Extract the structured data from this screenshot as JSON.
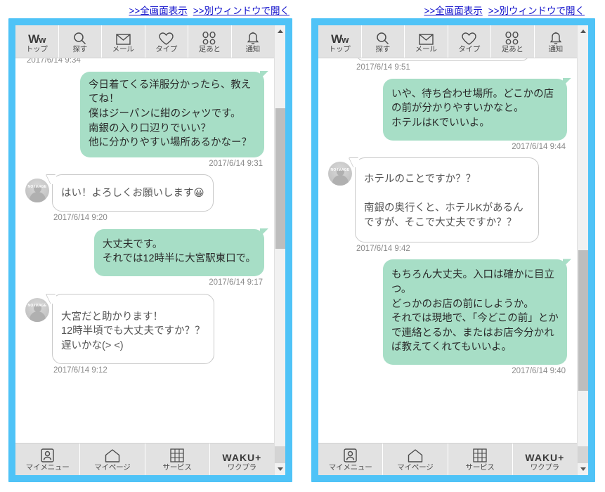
{
  "page": {
    "background": "#ffffff",
    "frame_color": "#4fc3f7",
    "bubble_out_color": "#a7dec6",
    "bubble_in_color": "#ffffff",
    "link_color": "#1414cc"
  },
  "panels": [
    {
      "id": "left",
      "header_links": [
        {
          "label": ">>全画面表示",
          "name": "fullscreen-link"
        },
        {
          "label": ">>別ウィンドウで開く",
          "name": "new-window-link"
        }
      ],
      "topnav": [
        {
          "icon": "logo-ww-icon",
          "label": "トップ"
        },
        {
          "icon": "search-icon",
          "label": "探す"
        },
        {
          "icon": "mail-icon",
          "label": "メール"
        },
        {
          "icon": "heart-icon",
          "label": "タイプ"
        },
        {
          "icon": "footprints-icon",
          "label": "足あと"
        },
        {
          "icon": "bell-icon",
          "label": "通知"
        }
      ],
      "bottomnav": [
        {
          "icon": "person-card-icon",
          "label": "マイメニュー"
        },
        {
          "icon": "home-icon",
          "label": "マイページ"
        },
        {
          "icon": "grid-icon",
          "label": "サービス"
        },
        {
          "icon": "wakuplus-logo-icon",
          "label": "ワクプラ",
          "logo": "WAKU+"
        }
      ],
      "messages": [
        {
          "side": "in",
          "partial": true,
          "text": "",
          "stamp": "2017/6/14 9:34"
        },
        {
          "side": "out",
          "text": "今日着てくる洋服分かったら、教えてね！\n僕はジーパンに紺のシャツです。\n南銀の入り口辺りでいい？\n他に分かりやすい場所あるかなー？",
          "stamp": "2017/6/14 9:31"
        },
        {
          "side": "in",
          "avatar": "NO IMAGE",
          "text": "はい！よろしくお願いします😀",
          "stamp": "2017/6/14 9:20"
        },
        {
          "side": "out",
          "text": "大丈夫です。\nそれでは12時半に大宮駅東口で。",
          "stamp": "2017/6/14 9:17"
        },
        {
          "side": "in",
          "avatar": "NO IMAGE",
          "text": "大宮だと助かります！\n12時半頃でも大丈夫ですか？？\n遅いかな(> <)",
          "stamp": "2017/6/14 9:12"
        }
      ]
    },
    {
      "id": "right",
      "header_links": [
        {
          "label": ">>全画面表示",
          "name": "fullscreen-link"
        },
        {
          "label": ">>別ウィンドウで開く",
          "name": "new-window-link"
        }
      ],
      "topnav": [
        {
          "icon": "logo-ww-icon",
          "label": "トップ"
        },
        {
          "icon": "search-icon",
          "label": "探す"
        },
        {
          "icon": "mail-icon",
          "label": "メール"
        },
        {
          "icon": "heart-icon",
          "label": "タイプ"
        },
        {
          "icon": "footprints-icon",
          "label": "足あと"
        },
        {
          "icon": "bell-icon",
          "label": "通知"
        }
      ],
      "bottomnav": [
        {
          "icon": "person-card-icon",
          "label": "マイメニュー"
        },
        {
          "icon": "home-icon",
          "label": "マイページ"
        },
        {
          "icon": "grid-icon",
          "label": "サービス"
        },
        {
          "icon": "wakuplus-logo-icon",
          "label": "ワクプラ",
          "logo": "WAKU+"
        }
      ],
      "messages": [
        {
          "side": "in",
          "partial": true,
          "text": "",
          "stamp": "2017/6/14 9:51"
        },
        {
          "side": "out",
          "text": "いや、待ち合わせ場所。どこかの店の前が分かりやすいかなと。\nホテルはKでいいよ。",
          "stamp": "2017/6/14 9:44"
        },
        {
          "side": "in",
          "avatar": "NO IMAGE",
          "text": "ホテルのことですか？？\n\n南銀の奥行くと、ホテルKがあるんですが、そこで大丈夫ですか？？",
          "stamp": "2017/6/14 9:42"
        },
        {
          "side": "out",
          "text": "もちろん大丈夫。入口は確かに目立つ。\nどっかのお店の前にしようか。\nそれでは現地で、「今どこの前」とかで連絡とるか、またはお店今分かれば教えてくれてもいいよ。",
          "stamp": "2017/6/14 9:40"
        }
      ]
    }
  ]
}
